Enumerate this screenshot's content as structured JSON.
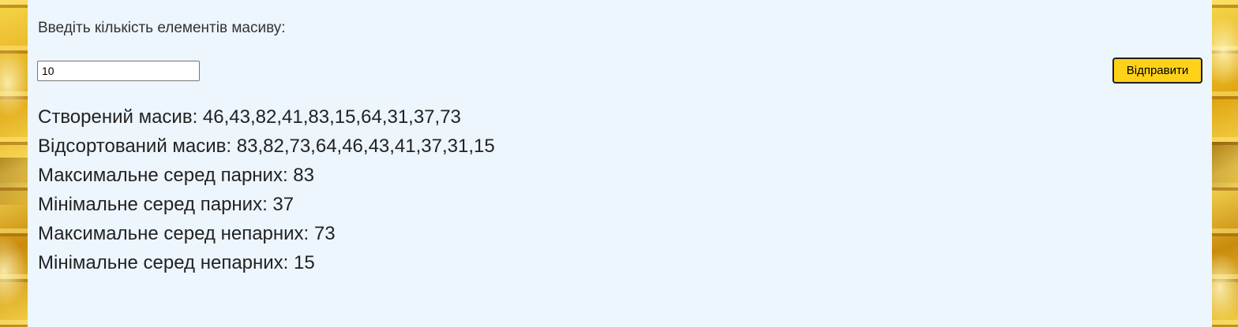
{
  "form": {
    "prompt_label": "Введіть кількість елементів масиву:",
    "count_value": "10",
    "submit_label": "Відправити"
  },
  "results": {
    "created": "Створений масив: 46,43,82,41,83,15,64,31,37,73",
    "sorted": "Відсортований масив: 83,82,73,64,46,43,41,37,31,15",
    "max_even": "Максимальне серед парних: 83",
    "min_even": "Мінімальне серед парних: 37",
    "max_odd": "Максимальне серед непарних: 73",
    "min_odd": "Мінімальне серед непарних: 15"
  },
  "colors": {
    "panel_background": "#edf5fd",
    "button_background": "#ffd21a",
    "page_background": "#e0b320"
  }
}
